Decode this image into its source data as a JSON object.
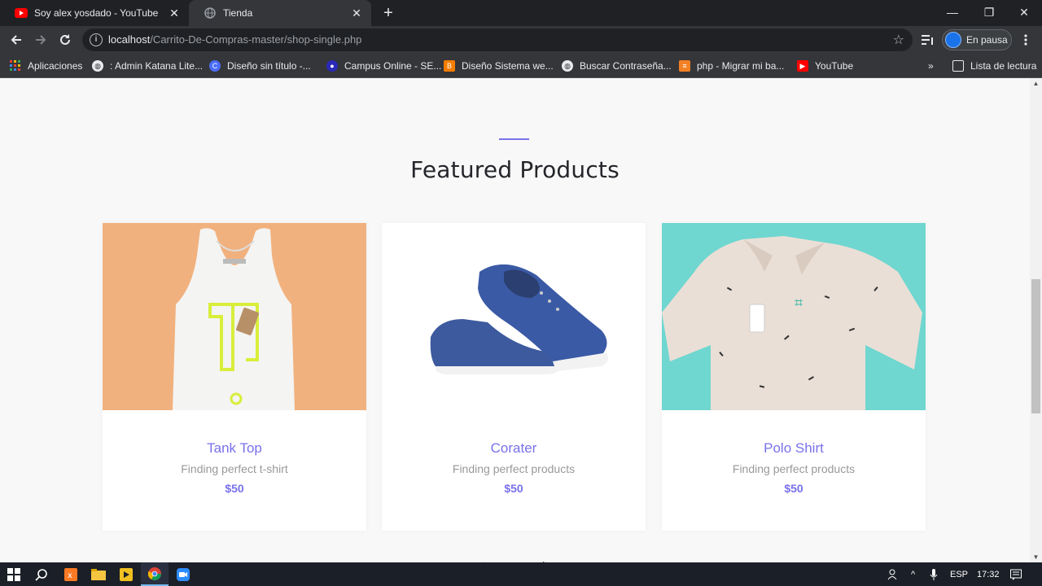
{
  "browser": {
    "tabs": [
      {
        "title": "Soy alex yosdado - YouTube",
        "active": false,
        "favicon": "youtube-icon"
      },
      {
        "title": "Tienda",
        "active": true,
        "favicon": "globe-icon"
      }
    ],
    "address": {
      "host": "localhost",
      "path": "/Carrito-De-Compras-master/shop-single.php"
    },
    "profile_label": "En pausa",
    "bookmarks": [
      {
        "label": "Aplicaciones",
        "icon": "apps-grid-icon"
      },
      {
        "label": ": Admin Katana Lite...",
        "icon": "globe-icon"
      },
      {
        "label": "Diseño sin título -...",
        "icon": "canva-icon"
      },
      {
        "label": "Campus Online - SE...",
        "icon": "campus-icon"
      },
      {
        "label": "Diseño Sistema we...",
        "icon": "blogger-icon"
      },
      {
        "label": "Buscar Contraseña...",
        "icon": "globe-icon"
      },
      {
        "label": "php - Migrar mi ba...",
        "icon": "stack-icon"
      },
      {
        "label": "YouTube",
        "icon": "youtube-icon"
      }
    ],
    "reading_list": "Lista de lectura"
  },
  "page": {
    "heading": "Featured Products",
    "products": [
      {
        "name": "Tank Top",
        "description": "Finding perfect t-shirt",
        "price": "$50"
      },
      {
        "name": "Corater",
        "description": "Finding perfect products",
        "price": "$50"
      },
      {
        "name": "Polo Shirt",
        "description": "Finding perfect products",
        "price": "$50"
      }
    ]
  },
  "taskbar": {
    "language": "ESP",
    "time": "17:32"
  },
  "colors": {
    "accent": "#7971ea",
    "tank_bg": "#f1b17e",
    "polo_bg": "#6fd6d0"
  }
}
